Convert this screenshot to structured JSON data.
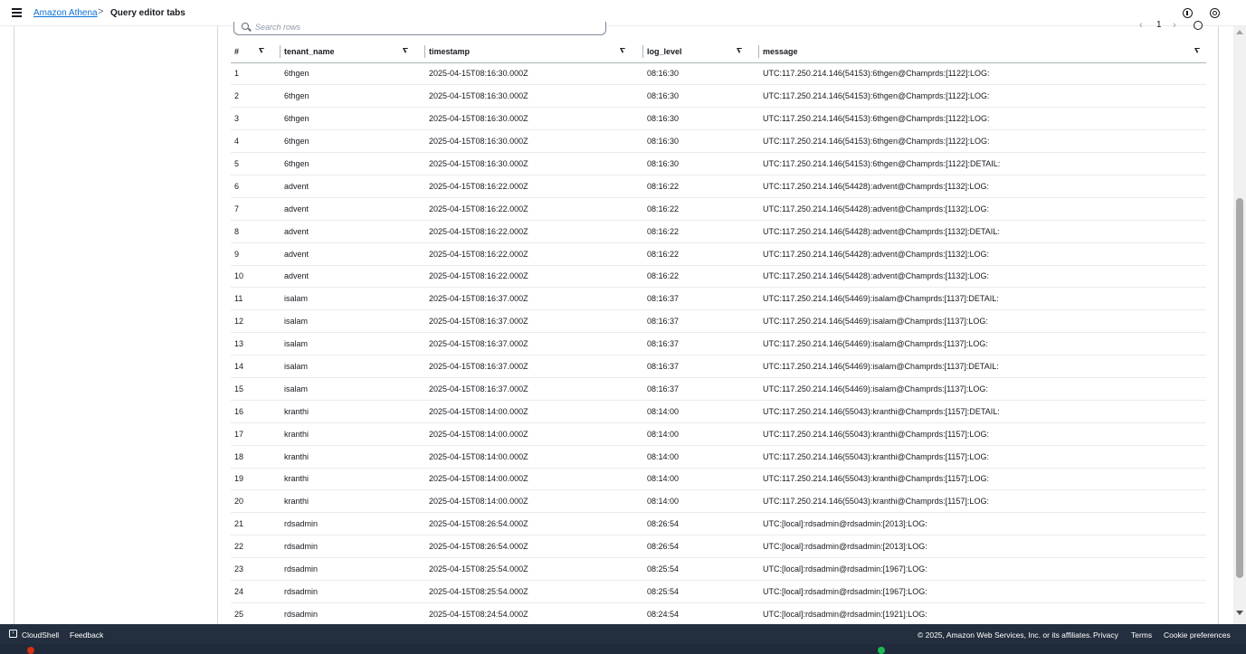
{
  "topbar": {
    "service_link": "Amazon Athena",
    "separator": ">",
    "current_page": "Query editor tabs"
  },
  "search": {
    "placeholder": "Search rows"
  },
  "pagination": {
    "prev": "‹",
    "page": "1",
    "next": "›"
  },
  "table": {
    "columns": [
      "#",
      "tenant_name",
      "timestamp",
      "log_level",
      "message"
    ],
    "rows": [
      [
        "1",
        "6thgen",
        "2025-04-15T08:16:30.000Z",
        "08:16:30",
        "UTC:117.250.214.146(54153):6thgen@Champrds:[1122]:LOG:"
      ],
      [
        "2",
        "6thgen",
        "2025-04-15T08:16:30.000Z",
        "08:16:30",
        "UTC:117.250.214.146(54153):6thgen@Champrds:[1122]:LOG:"
      ],
      [
        "3",
        "6thgen",
        "2025-04-15T08:16:30.000Z",
        "08:16:30",
        "UTC:117.250.214.146(54153):6thgen@Champrds:[1122]:LOG:"
      ],
      [
        "4",
        "6thgen",
        "2025-04-15T08:16:30.000Z",
        "08:16:30",
        "UTC:117.250.214.146(54153):6thgen@Champrds:[1122]:LOG:"
      ],
      [
        "5",
        "6thgen",
        "2025-04-15T08:16:30.000Z",
        "08:16:30",
        "UTC:117.250.214.146(54153):6thgen@Champrds:[1122]:DETAIL:"
      ],
      [
        "6",
        "advent",
        "2025-04-15T08:16:22.000Z",
        "08:16:22",
        "UTC:117.250.214.146(54428):advent@Champrds:[1132]:LOG:"
      ],
      [
        "7",
        "advent",
        "2025-04-15T08:16:22.000Z",
        "08:16:22",
        "UTC:117.250.214.146(54428):advent@Champrds:[1132]:LOG:"
      ],
      [
        "8",
        "advent",
        "2025-04-15T08:16:22.000Z",
        "08:16:22",
        "UTC:117.250.214.146(54428):advent@Champrds:[1132]:DETAIL:"
      ],
      [
        "9",
        "advent",
        "2025-04-15T08:16:22.000Z",
        "08:16:22",
        "UTC:117.250.214.146(54428):advent@Champrds:[1132]:LOG:"
      ],
      [
        "10",
        "advent",
        "2025-04-15T08:16:22.000Z",
        "08:16:22",
        "UTC:117.250.214.146(54428):advent@Champrds:[1132]:LOG:"
      ],
      [
        "11",
        "isalam",
        "2025-04-15T08:16:37.000Z",
        "08:16:37",
        "UTC:117.250.214.146(54469):isalam@Champrds:[1137]:DETAIL:"
      ],
      [
        "12",
        "isalam",
        "2025-04-15T08:16:37.000Z",
        "08:16:37",
        "UTC:117.250.214.146(54469):isalam@Champrds:[1137]:LOG:"
      ],
      [
        "13",
        "isalam",
        "2025-04-15T08:16:37.000Z",
        "08:16:37",
        "UTC:117.250.214.146(54469):isalam@Champrds:[1137]:LOG:"
      ],
      [
        "14",
        "isalam",
        "2025-04-15T08:16:37.000Z",
        "08:16:37",
        "UTC:117.250.214.146(54469):isalam@Champrds:[1137]:DETAIL:"
      ],
      [
        "15",
        "isalam",
        "2025-04-15T08:16:37.000Z",
        "08:16:37",
        "UTC:117.250.214.146(54469):isalam@Champrds:[1137]:LOG:"
      ],
      [
        "16",
        "kranthi",
        "2025-04-15T08:14:00.000Z",
        "08:14:00",
        "UTC:117.250.214.146(55043):kranthi@Champrds:[1157]:DETAIL:"
      ],
      [
        "17",
        "kranthi",
        "2025-04-15T08:14:00.000Z",
        "08:14:00",
        "UTC:117.250.214.146(55043):kranthi@Champrds:[1157]:LOG:"
      ],
      [
        "18",
        "kranthi",
        "2025-04-15T08:14:00.000Z",
        "08:14:00",
        "UTC:117.250.214.146(55043):kranthi@Champrds:[1157]:LOG:"
      ],
      [
        "19",
        "kranthi",
        "2025-04-15T08:14:00.000Z",
        "08:14:00",
        "UTC:117.250.214.146(55043):kranthi@Champrds:[1157]:LOG:"
      ],
      [
        "20",
        "kranthi",
        "2025-04-15T08:14:00.000Z",
        "08:14:00",
        "UTC:117.250.214.146(55043):kranthi@Champrds:[1157]:LOG:"
      ],
      [
        "21",
        "rdsadmin",
        "2025-04-15T08:26:54.000Z",
        "08:26:54",
        "UTC:[local]:rdsadmin@rdsadmin:[2013]:LOG:"
      ],
      [
        "22",
        "rdsadmin",
        "2025-04-15T08:26:54.000Z",
        "08:26:54",
        "UTC:[local]:rdsadmin@rdsadmin:[2013]:LOG:"
      ],
      [
        "23",
        "rdsadmin",
        "2025-04-15T08:25:54.000Z",
        "08:25:54",
        "UTC:[local]:rdsadmin@rdsadmin:[1967]:LOG:"
      ],
      [
        "24",
        "rdsadmin",
        "2025-04-15T08:25:54.000Z",
        "08:25:54",
        "UTC:[local]:rdsadmin@rdsadmin:[1967]:LOG:"
      ],
      [
        "25",
        "rdsadmin",
        "2025-04-15T08:24:54.000Z",
        "08:24:54",
        "UTC:[local]:rdsadmin@rdsadmin:[1921]:LOG:"
      ]
    ]
  },
  "footer": {
    "cloudshell": "CloudShell",
    "feedback": "Feedback",
    "copyright": "© 2025, Amazon Web Services, Inc. or its affiliates.",
    "privacy": "Privacy",
    "terms": "Terms",
    "cookies": "Cookie preferences"
  },
  "colors": {
    "link": "#0972d3",
    "footer_bg": "#232f3e",
    "text": "#16191f"
  }
}
